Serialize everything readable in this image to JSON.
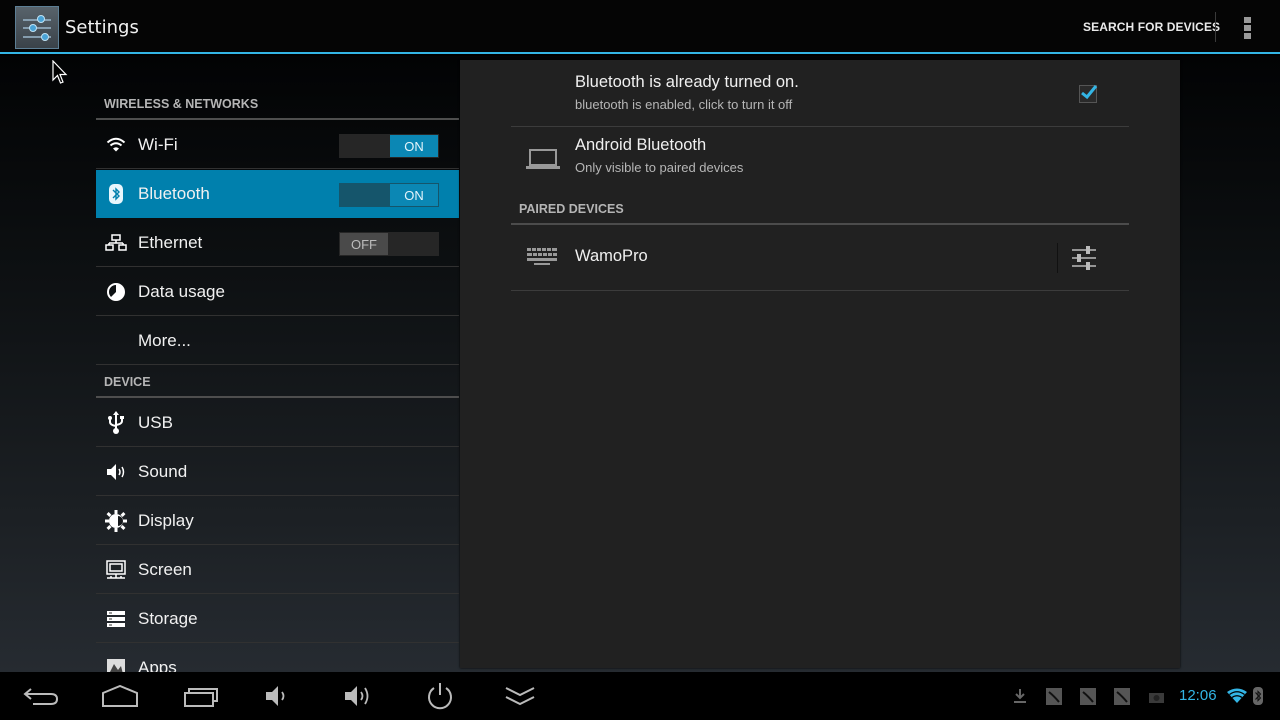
{
  "actionbar": {
    "title": "Settings",
    "app_icon": "settings-sliders-icon",
    "search_devices_label": "SEARCH FOR DEVICES",
    "overflow_icon": "overflow-menu-icon"
  },
  "headers": {
    "categories": [
      {
        "title": "WIRELESS & NETWORKS"
      },
      {
        "title": "DEVICE"
      }
    ],
    "items": [
      {
        "label": "Wi-Fi",
        "icon": "wifi-icon",
        "toggle": "ON",
        "toggle_state": "on"
      },
      {
        "label": "Bluetooth",
        "icon": "bluetooth-icon",
        "toggle": "ON",
        "toggle_state": "on",
        "selected": true
      },
      {
        "label": "Ethernet",
        "icon": "ethernet-icon",
        "toggle": "OFF",
        "toggle_state": "off"
      },
      {
        "label": "Data usage",
        "icon": "data-usage-icon"
      },
      {
        "label": "More..."
      },
      {
        "label": "USB",
        "icon": "usb-icon"
      },
      {
        "label": "Sound",
        "icon": "sound-icon"
      },
      {
        "label": "Display",
        "icon": "display-icon"
      },
      {
        "label": "Screen",
        "icon": "screen-icon"
      },
      {
        "label": "Storage",
        "icon": "storage-icon"
      },
      {
        "label": "Apps",
        "icon": "apps-icon"
      }
    ]
  },
  "bluetooth_panel": {
    "status_title": "Bluetooth is already turned on.",
    "status_summary": "bluetooth is enabled, click to turn it off",
    "status_checked": true,
    "device_name": "Android Bluetooth",
    "device_visibility": "Only visible to paired devices",
    "paired_header": "PAIRED DEVICES",
    "paired_devices": [
      {
        "name": "WamoPro",
        "icon": "keyboard-icon",
        "settings_icon": "device-settings-icon"
      }
    ]
  },
  "navbar": {
    "buttons": [
      "back",
      "home",
      "recent-apps",
      "volume-down",
      "volume-up",
      "power",
      "collapse"
    ],
    "status": {
      "time": "12:06",
      "icons": [
        "download-icon",
        "notification-icon",
        "notification-icon",
        "notification-icon",
        "screenshot-icon",
        "wifi-signal-icon",
        "bluetooth-status-icon"
      ]
    }
  },
  "colors": {
    "accent": "#33b5e5",
    "selected_item": "#0080ad",
    "toggle_on": "#0b87b4"
  }
}
